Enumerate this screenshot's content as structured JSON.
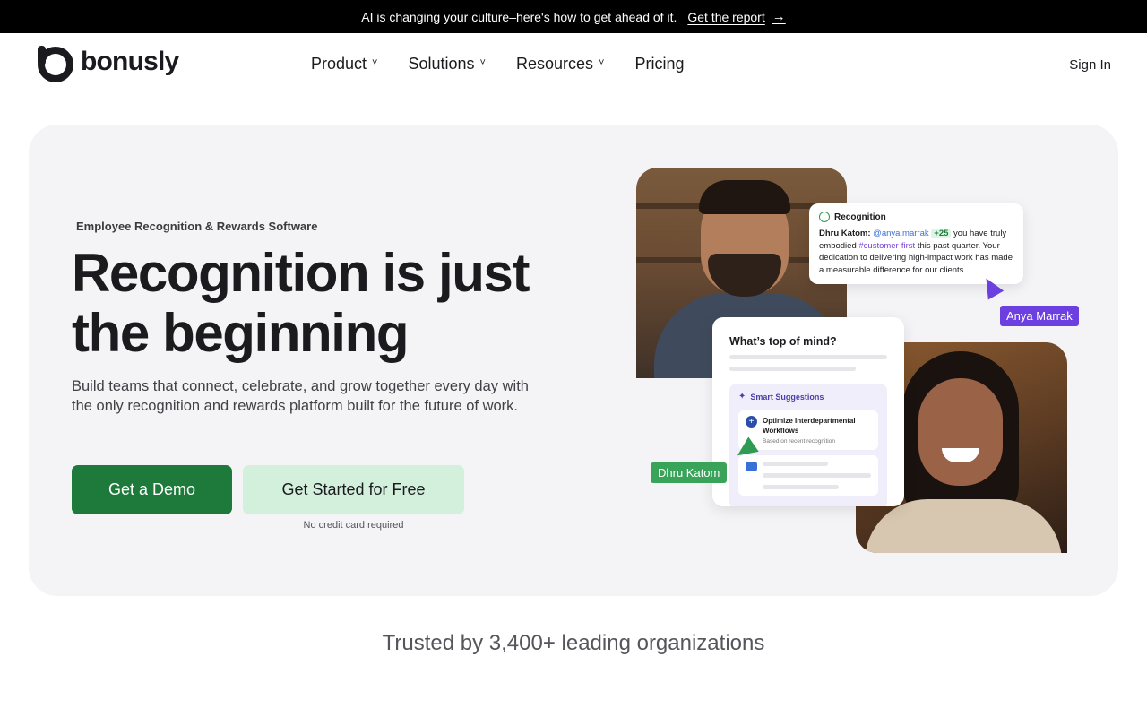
{
  "announcement": {
    "message": "AI is changing your culture–here's how to get ahead of it.",
    "link_label": "Get the report",
    "arrow": "→"
  },
  "nav": {
    "logo_text": "bonusly",
    "items": [
      {
        "label": "Product",
        "has_dropdown": true
      },
      {
        "label": "Solutions",
        "has_dropdown": true
      },
      {
        "label": "Resources",
        "has_dropdown": true
      },
      {
        "label": "Pricing",
        "has_dropdown": false
      }
    ],
    "dropdown_glyph": "˅",
    "sign_in": "Sign In"
  },
  "hero": {
    "eyebrow": "Employee Recognition & Rewards Software",
    "headline_line1": "Recognition is just",
    "headline_line2": "the beginning",
    "subtext": "Build teams that connect, celebrate, and grow together every day with the only recognition and rewards platform built for the future of work.",
    "primary_cta": "Get a Demo",
    "secondary_cta": "Get Started for Free",
    "no_card_note": "No credit card required"
  },
  "illustration": {
    "recognition_card": {
      "title": "Recognition",
      "sender": "Dhru Katom:",
      "mention": "@anya.marrak",
      "points": "+25",
      "text_a": "you have truly embodied",
      "hashtag": "#customer-first",
      "text_b": "this past quarter. Your dedication to delivering high-impact work has made a measurable difference for our clients."
    },
    "anya_label": "Anya Marrak",
    "dhru_label": "Dhru Katom",
    "mind_card": {
      "question": "What’s top of mind?",
      "smart_header": "Smart Suggestions",
      "suggestion_title": "Optimize Interdepartmental Workflows",
      "suggestion_sub": "Based on recent recognition",
      "plus_glyph": "+",
      "spark_glyph": "✦"
    }
  },
  "trusted": "Trusted by 3,400+ leading organizations",
  "colors": {
    "primary_green": "#1d7a3a",
    "light_green": "#d3f0dc",
    "purple": "#6c3fe0",
    "hero_bg": "#f4f4f7"
  }
}
